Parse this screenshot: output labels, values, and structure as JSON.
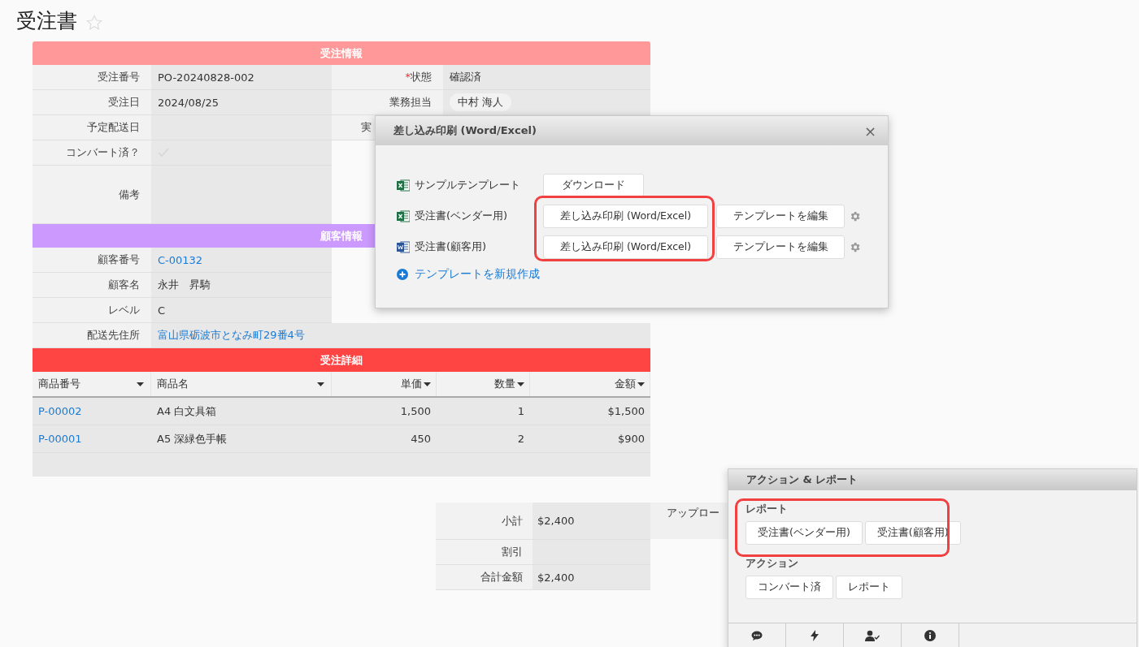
{
  "title": "受注書",
  "order_info": {
    "title": "受注情報",
    "rows": [
      {
        "label": "受注番号",
        "value": {
          "kind": "text",
          "text": "PO-20240828-002"
        },
        "right": {
          "mark": "*",
          "label": "状態",
          "value": {
            "kind": "text",
            "text": "確認済"
          }
        }
      },
      {
        "label": "受注日",
        "value": {
          "kind": "text",
          "text": "2024/08/25"
        },
        "right": {
          "label": "業務担当",
          "value": {
            "kind": "chip",
            "text": "中村 海人"
          }
        }
      },
      {
        "label": "予定配送日",
        "value": {
          "kind": "empty"
        },
        "right": {
          "label": "実"
        }
      },
      {
        "label": "コンバート済？",
        "value": {
          "kind": "check",
          "checked": true
        }
      },
      {
        "label": "備考",
        "value": {
          "kind": "empty"
        },
        "tall": true
      }
    ]
  },
  "customer_info": {
    "title": "顧客情報",
    "rows": [
      {
        "label": "顧客番号",
        "value": {
          "kind": "link",
          "text": "C-00132"
        }
      },
      {
        "label": "顧客名",
        "value": {
          "kind": "text",
          "text": "永井　昇騎"
        }
      },
      {
        "label": "レベル",
        "value": {
          "kind": "text",
          "text": "C"
        }
      },
      {
        "label": "配送先住所",
        "value": {
          "kind": "link",
          "text": "富山県砺波市となみ町29番4号"
        },
        "wide": true
      }
    ]
  },
  "order_details": {
    "title": "受注詳細",
    "columns": [
      {
        "label": "商品番号",
        "kind": "link"
      },
      {
        "label": "商品名",
        "kind": "text"
      },
      {
        "label": "単価",
        "kind": "number"
      },
      {
        "label": "数量",
        "kind": "number"
      },
      {
        "label": "金額",
        "kind": "number"
      }
    ],
    "rows": [
      [
        "P-00002",
        "A4 白文具箱",
        "1,500",
        "1",
        "$1,500"
      ],
      [
        "P-00001",
        "A5 深緑色手帳",
        "450",
        "2",
        "$900"
      ]
    ]
  },
  "totals": [
    {
      "label": "小計",
      "value": "$2,400"
    },
    {
      "label": "割引"
    },
    {
      "label": "合計金額",
      "value": "$2,400"
    }
  ],
  "approval_label": "アップロー",
  "dialog": {
    "title": "差し込み印刷 (Word/Excel)",
    "close": "×",
    "highlighted": true,
    "rows": [
      {
        "kind": "excel",
        "label": "サンプルテンプレート",
        "buttons": [
          "ダウンロード"
        ],
        "settings": false
      },
      {
        "kind": "excel",
        "label": "受注書(ベンダー用)",
        "buttons": [
          "差し込み印刷 (Word/Excel)",
          "テンプレートを編集"
        ],
        "settings": true
      },
      {
        "kind": "word",
        "label": "受注書(顧客用)",
        "buttons": [
          "差し込み印刷 (Word/Excel)",
          "テンプレートを編集"
        ],
        "settings": true
      }
    ],
    "new_link": "テンプレートを新規作成"
  },
  "action_panel": {
    "title": "アクション & レポート",
    "sections": [
      {
        "title": "レポート",
        "highlighted": true,
        "buttons": [
          "受注書(ベンダー用)",
          "受注書(顧客用)"
        ]
      },
      {
        "title": "アクション",
        "highlighted": false,
        "buttons": [
          "コンバート済",
          "レポート"
        ]
      }
    ]
  }
}
